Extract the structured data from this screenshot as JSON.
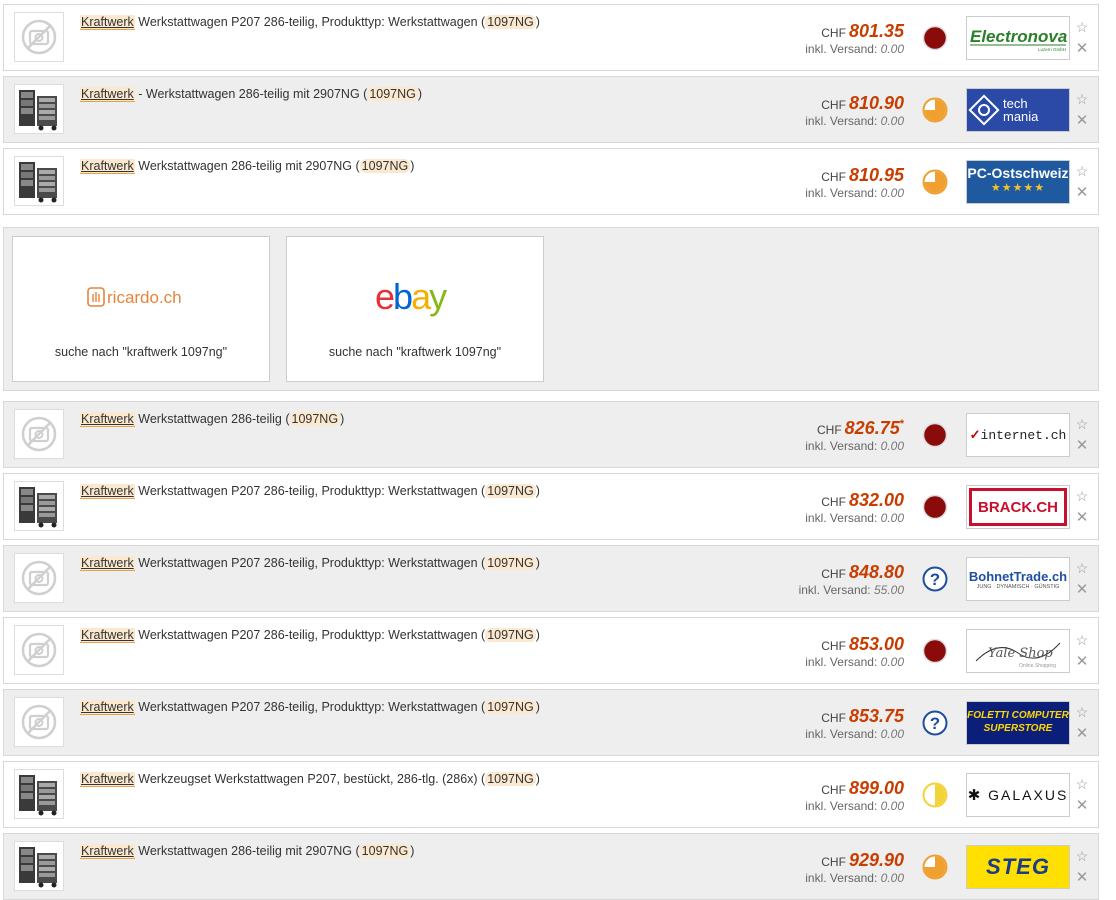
{
  "currency": "CHF",
  "shipping_label": "inkl. Versand:",
  "offers": [
    {
      "brand": "Kraftwerk",
      "title_mid": " Werkstattwagen P207 286-teilig, Produkttyp: Werkstattwagen (",
      "code": "1097NG",
      "title_end": ")",
      "price": "801.35",
      "shipping": "0.00",
      "status": "red",
      "shop": "Electronova",
      "thumb": "placeholder",
      "star": false
    },
    {
      "brand": "Kraftwerk",
      "title_mid": " - Werkstattwagen 286-teilig mit 2907NG (",
      "code": "1097NG",
      "title_end": ")",
      "price": "810.90",
      "shipping": "0.00",
      "status": "orange",
      "shop": "tech mania",
      "thumb": "cart",
      "star": false
    },
    {
      "brand": "Kraftwerk",
      "title_mid": " Werkstattwagen 286-teilig mit 2907NG (",
      "code": "1097NG",
      "title_end": ")",
      "price": "810.95",
      "shipping": "0.00",
      "status": "orange",
      "shop": "PC-Ostschweiz",
      "thumb": "cart",
      "star": false
    },
    {
      "brand": "Kraftwerk",
      "title_mid": " Werkstattwagen 286-teilig (",
      "code": "1097NG",
      "title_end": ")",
      "price": "826.75",
      "shipping": "0.00",
      "status": "red",
      "shop": "internet.ch",
      "thumb": "placeholder",
      "star": true
    },
    {
      "brand": "Kraftwerk",
      "title_mid": " Werkstattwagen P207 286-teilig, Produkttyp: Werkstattwagen (",
      "code": "1097NG",
      "title_end": ")",
      "price": "832.00",
      "shipping": "0.00",
      "status": "red",
      "shop": "BRACK.CH",
      "thumb": "cart",
      "star": false
    },
    {
      "brand": "Kraftwerk",
      "title_mid": " Werkstattwagen P207 286-teilig, Produkttyp: Werkstattwagen (",
      "code": "1097NG",
      "title_end": ")",
      "price": "848.80",
      "shipping": "55.00",
      "status": "unknown",
      "shop": "BohnetTrade.ch",
      "thumb": "placeholder",
      "star": false
    },
    {
      "brand": "Kraftwerk",
      "title_mid": " Werkstattwagen P207 286-teilig, Produkttyp: Werkstattwagen (",
      "code": "1097NG",
      "title_end": ")",
      "price": "853.00",
      "shipping": "0.00",
      "status": "red",
      "shop": "YaleShop",
      "thumb": "placeholder",
      "star": false
    },
    {
      "brand": "Kraftwerk",
      "title_mid": " Werkstattwagen P207 286-teilig, Produkttyp: Werkstattwagen (",
      "code": "1097NG",
      "title_end": ")",
      "price": "853.75",
      "shipping": "0.00",
      "status": "unknown",
      "shop": "FOLETTI COMPUTER SUPERSTORE",
      "thumb": "placeholder",
      "star": false
    },
    {
      "brand": "Kraftwerk",
      "title_mid": " Werkzeugset Werkstattwagen P207, bestückt, 286-tlg. (286x) (",
      "code": "1097NG",
      "title_end": ")",
      "price": "899.00",
      "shipping": "0.00",
      "status": "yellow",
      "shop": "GALAXUS",
      "thumb": "cart",
      "star": false
    },
    {
      "brand": "Kraftwerk",
      "title_mid": " Werkstattwagen 286-teilig mit 2907NG (",
      "code": "1097NG",
      "title_end": ")",
      "price": "929.90",
      "shipping": "0.00",
      "status": "orange",
      "shop": "STEG",
      "thumb": "cart",
      "star": false
    }
  ],
  "marketplaces": [
    {
      "name": "ricardo.ch",
      "search_text": "suche nach \"kraftwerk 1097ng\""
    },
    {
      "name": "ebay",
      "search_text": "suche nach \"kraftwerk 1097ng\""
    }
  ],
  "shop_logos": {
    "electronova_sub": "Luzern GmbH",
    "bohnet_sub": "JUNG · DYNAMISCH · GÜNSTIG",
    "foletti_line1": "FOLETTI COMPUTER",
    "foletti_line2": "SUPERSTORE",
    "tech_line1": "tech",
    "tech_line2": "mania",
    "pcost_stars": "★★★★★",
    "yale_sub": "Online Shopping"
  },
  "colors": {
    "price": "#c83d00",
    "status_red": "#8b0a0a",
    "status_orange": "#f0a030",
    "status_yellow": "#f3d33a",
    "status_unknown": "#1f4fa0"
  }
}
